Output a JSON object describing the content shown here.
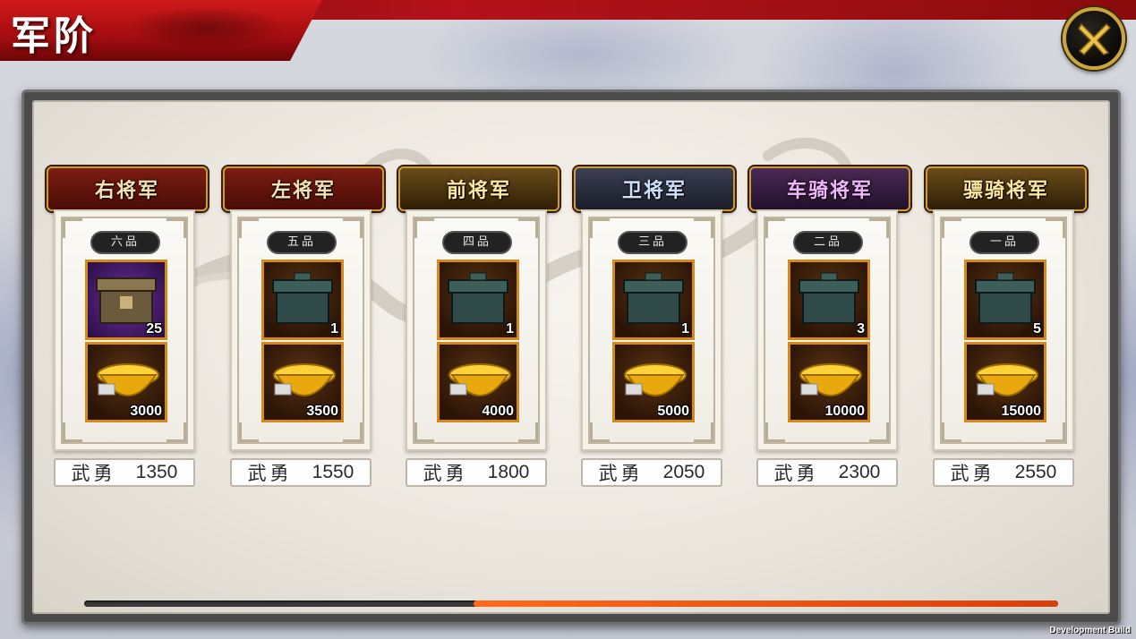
{
  "title": "军阶",
  "close_icon": "close-x-icon",
  "colors": {
    "accent_red": "#b5121b",
    "progress_orange": "#ff6a1a",
    "slot_border": "#d58a18"
  },
  "progress": {
    "fill_fraction": 0.6
  },
  "ranks": [
    {
      "name": "右将军",
      "grade": "六品",
      "item_icon": "purple-chest-icon",
      "item_count": "25",
      "gold_icon": "gold-ingot-icon",
      "gold_amount": "3000",
      "valor_label": "武勇",
      "valor_value": "1350"
    },
    {
      "name": "左将军",
      "grade": "五品",
      "item_icon": "bronze-chest-icon",
      "item_count": "1",
      "gold_icon": "gold-ingot-icon",
      "gold_amount": "3500",
      "valor_label": "武勇",
      "valor_value": "1550"
    },
    {
      "name": "前将军",
      "grade": "四品",
      "item_icon": "bronze-chest-icon",
      "item_count": "1",
      "gold_icon": "gold-ingot-icon",
      "gold_amount": "4000",
      "valor_label": "武勇",
      "valor_value": "1800"
    },
    {
      "name": "卫将军",
      "grade": "三品",
      "item_icon": "bronze-chest-icon",
      "item_count": "1",
      "gold_icon": "gold-ingot-icon",
      "gold_amount": "5000",
      "valor_label": "武勇",
      "valor_value": "2050"
    },
    {
      "name": "车骑将军",
      "grade": "二品",
      "item_icon": "bronze-chest-icon",
      "item_count": "3",
      "gold_icon": "gold-ingot-icon",
      "gold_amount": "10000",
      "valor_label": "武勇",
      "valor_value": "2300"
    },
    {
      "name": "骠骑将军",
      "grade": "一品",
      "item_icon": "bronze-chest-icon",
      "item_count": "5",
      "gold_icon": "gold-ingot-icon",
      "gold_amount": "15000",
      "valor_label": "武勇",
      "valor_value": "2550"
    }
  ],
  "footer": {
    "build_label": "Development Build"
  }
}
